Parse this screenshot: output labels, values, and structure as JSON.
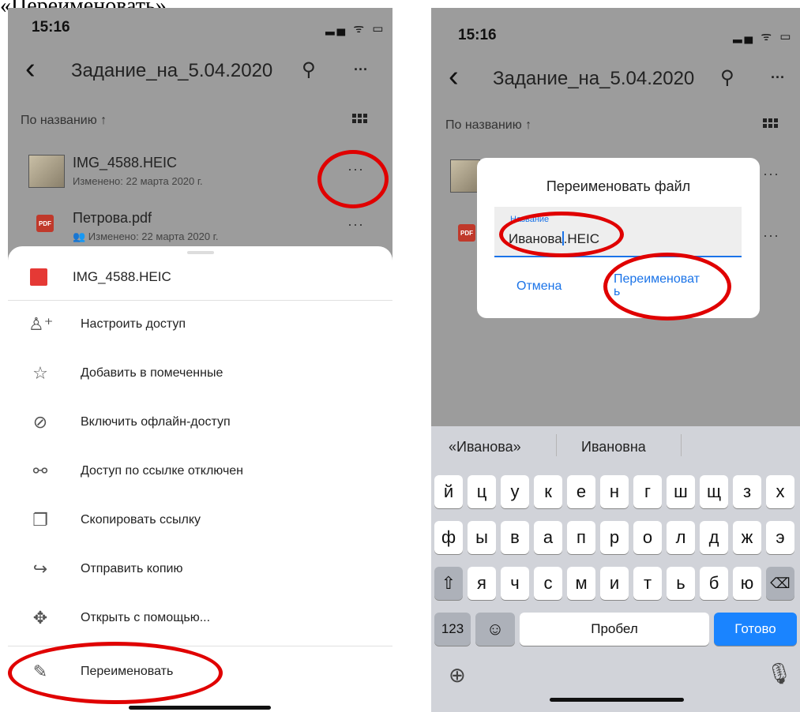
{
  "caption": "«Переименовать».",
  "left": {
    "status": {
      "time": "15:16"
    },
    "nav": {
      "title": "Задание_на_5.04.2020"
    },
    "sort": {
      "label": "По названию ↑"
    },
    "files": [
      {
        "name": "IMG_4588.HEIC",
        "meta": "Изменено: 22 марта 2020 г."
      },
      {
        "name": "Петрова.pdf",
        "meta": "👥 Изменено: 22 марта 2020 г.",
        "badge": "PDF"
      }
    ],
    "sheet": {
      "file": "IMG_4588.HEIC",
      "items": [
        {
          "label": "Настроить доступ",
          "icon": "person-add-icon"
        },
        {
          "label": "Добавить в помеченные",
          "icon": "star-icon"
        },
        {
          "label": "Включить офлайн-доступ",
          "icon": "offline-check-icon"
        },
        {
          "label": "Доступ по ссылке отключен",
          "icon": "link-off-icon"
        },
        {
          "label": "Скопировать ссылку",
          "icon": "copy-icon"
        },
        {
          "label": "Отправить копию",
          "icon": "share-arrow-icon"
        },
        {
          "label": "Открыть с помощью...",
          "icon": "open-with-icon"
        },
        {
          "label": "Переименовать",
          "icon": "pencil-icon"
        }
      ]
    }
  },
  "right": {
    "status": {
      "time": "15:16"
    },
    "nav": {
      "title": "Задание_на_5.04.2020"
    },
    "sort": {
      "label": "По названию ↑"
    },
    "dialog": {
      "title": "Переименовать файл",
      "field_label": "Название",
      "value_before": "Иванова",
      "value_after": ".HEIC",
      "cancel": "Отмена",
      "confirm_line1": "Переименоват",
      "confirm_line2": "ь"
    },
    "keyboard": {
      "suggestions": [
        "«Иванова»",
        "Ивановна"
      ],
      "row1": [
        "й",
        "ц",
        "у",
        "к",
        "е",
        "н",
        "г",
        "ш",
        "щ",
        "з",
        "х"
      ],
      "row2": [
        "ф",
        "ы",
        "в",
        "а",
        "п",
        "р",
        "о",
        "л",
        "д",
        "ж",
        "э"
      ],
      "row3": [
        "я",
        "ч",
        "с",
        "м",
        "и",
        "т",
        "ь",
        "б",
        "ю"
      ],
      "numbers": "123",
      "space": "Пробел",
      "done": "Готово"
    }
  },
  "colors": {
    "accent": "#1a73e8",
    "highlight": "#e00000",
    "keyboard_done": "#1a84ff"
  }
}
